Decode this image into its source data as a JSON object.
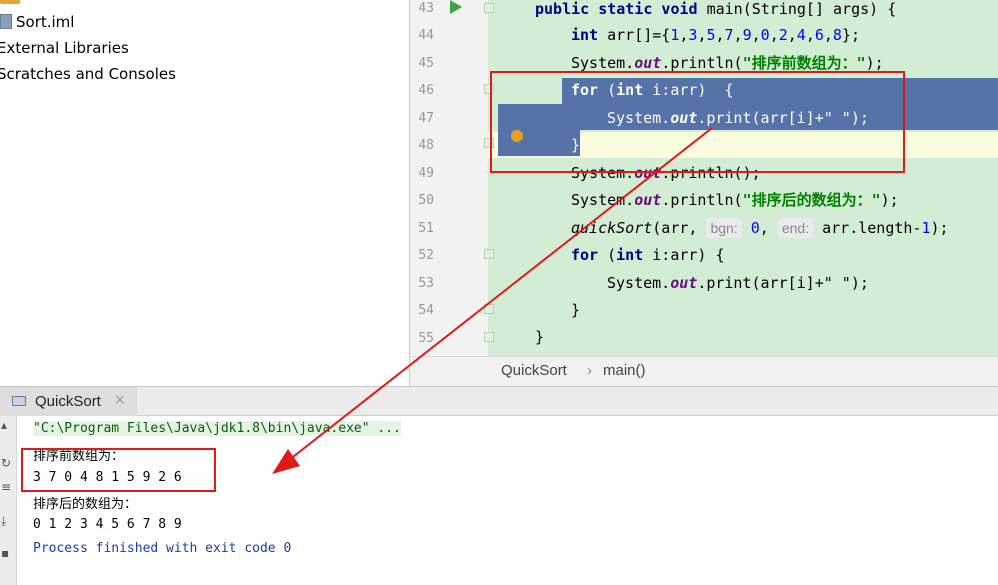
{
  "project_tree": {
    "items": [
      {
        "label": "Sort.iml",
        "icon": "iml-file-icon"
      },
      {
        "label": "External Libraries",
        "icon": "none"
      },
      {
        "label": "Scratches and Consoles",
        "icon": "none"
      }
    ]
  },
  "editor": {
    "line_numbers": [
      "43",
      "44",
      "45",
      "46",
      "47",
      "48",
      "49",
      "50",
      "51",
      "52",
      "53",
      "54",
      "55"
    ],
    "code": {
      "l43": {
        "kw1": "public static void ",
        "rest": "main(String[] args) {"
      },
      "l44": {
        "kw": "int ",
        "var": "arr",
        "mid": "[]={",
        "n1": "1",
        ",1": ",",
        "n2": "3",
        ",2": ",",
        "n3": "5",
        ",3": ",",
        "n4": "7",
        ",4": ",",
        "n5": "9",
        ",5": ",",
        "n6": "0",
        ",6": ",",
        "n7": "2",
        ",7": ",",
        "n8": "4",
        ",8": ",",
        "n9": "6",
        ",9": ",",
        "n10": "8",
        "end": "};"
      },
      "l45": {
        "a": "System.",
        "fld": "out",
        "b": ".println(",
        "str": "\"排序前数组为：\"",
        "c": ");"
      },
      "l46": {
        "kw": "for ",
        "a": "(",
        "kw2": "int ",
        "b": "i:arr)  {"
      },
      "l47": {
        "a": "System.",
        "fld": "out",
        "b": ".print(arr[i]+",
        "str": "\" \"",
        "c": ");"
      },
      "l48": {
        "a": "}"
      },
      "l49": {
        "a": "System.",
        "fld": "out",
        "b": ".println();"
      },
      "l50": {
        "a": "System.",
        "fld": "out",
        "b": ".println(",
        "str": "\"排序后的数组为：\"",
        "c": ");"
      },
      "l51": {
        "mth": "quickSort",
        "a": "(arr, ",
        "hint1": "bgn:",
        "n1": "0",
        ",": ", ",
        "hint2": "end:",
        "b": " arr.length-",
        "n2": "1",
        "c": ");"
      },
      "l52": {
        "kw": "for ",
        "a": "(",
        "kw2": "int ",
        "b": "i:arr) {"
      },
      "l53": {
        "a": "System.",
        "fld": "out",
        "b": ".print(arr[i]+",
        "str": "\" \"",
        "c": ");"
      },
      "l54": {
        "a": "}"
      },
      "l55": {
        "a": "}"
      }
    }
  },
  "breadcrumb": {
    "class": "QuickSort",
    "sep": "›",
    "method": "main()"
  },
  "run_panel": {
    "tab_label": "QuickSort",
    "tab_close": "×",
    "console": {
      "command": "\"C:\\Program Files\\Java\\jdk1.8\\bin\\java.exe\" ...",
      "lines": [
        "排序前数组为：",
        "3 7 0 4 8 1 5 9 2 6",
        "排序后的数组为：",
        "0 1 2 3 4 5 6 7 8 9"
      ],
      "exit": "Process finished with exit code 0"
    }
  },
  "colors": {
    "annotation": "#e01919",
    "code_bg": "#d3ecd4",
    "selection": "#5573a8"
  }
}
